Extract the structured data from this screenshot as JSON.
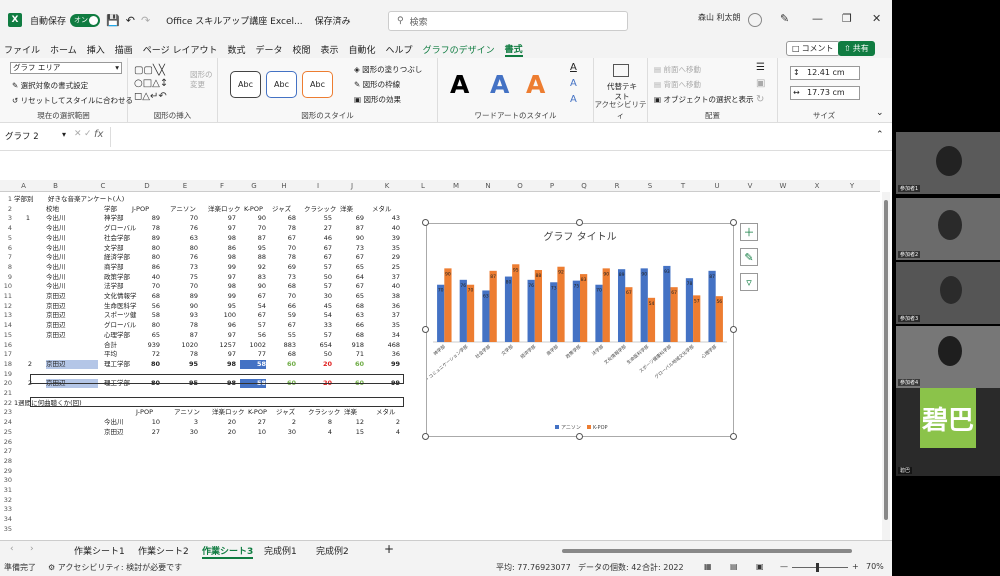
{
  "window": {
    "title": "Office スキルアップ講座 Excel...",
    "saved_label": "保存済み",
    "autosave_label": "自動保存",
    "autosave_state": "オン",
    "search_placeholder": "検索",
    "user_name": "森山 利太朗"
  },
  "menu": {
    "items": [
      "ファイル",
      "ホーム",
      "挿入",
      "描画",
      "ページ レイアウト",
      "数式",
      "データ",
      "校閲",
      "表示",
      "自動化",
      "ヘルプ"
    ],
    "chart_design": "グラフのデザイン",
    "format": "書式",
    "comment": "コメント",
    "share": "共有"
  },
  "ribbon": {
    "chart_area": "グラフ エリア",
    "format_selection": "選択対象の書式設定",
    "reset_style": "リセットしてスタイルに合わせる",
    "group_current": "現在の選択範囲",
    "shape_change": "図形の変更",
    "group_insert": "図形の挿入",
    "abc": "Abc",
    "fill": "図形の塗りつぶし",
    "outline": "図形の枠線",
    "effects": "図形の効果",
    "group_shape_styles": "図形のスタイル",
    "letter_a": "A",
    "group_wordart": "ワードアートのスタイル",
    "alt_text": "代替テキスト",
    "group_access": "アクセシビリティ",
    "bring_forward": "前面へ移動",
    "send_backward": "背面へ移動",
    "selection_pane": "オブジェクトの選択と表示",
    "group_arrange": "配置",
    "height": "12.41 cm",
    "width": "17.73 cm",
    "group_size": "サイズ"
  },
  "formula_bar": {
    "name_box": "グラフ 2",
    "fx": "fx"
  },
  "columns": [
    "A",
    "B",
    "C",
    "D",
    "E",
    "F",
    "G",
    "H",
    "I",
    "J",
    "K",
    "L",
    "M",
    "N",
    "O",
    "P",
    "Q",
    "R",
    "S",
    "T",
    "U",
    "V",
    "W",
    "X",
    "Y"
  ],
  "rows": [
    "1",
    "2",
    "3",
    "4",
    "5",
    "6",
    "7",
    "8",
    "9",
    "10",
    "11",
    "12",
    "13",
    "14",
    "15",
    "16",
    "17",
    "18",
    "19",
    "20",
    "21",
    "22",
    "23",
    "24",
    "25",
    "26",
    "27",
    "28",
    "29",
    "30",
    "31",
    "32",
    "33",
    "34",
    "35"
  ],
  "sheet": {
    "r1a": "学部別",
    "r1b": "好きな音楽アンケート(人)",
    "header": [
      "校地",
      "学部",
      "J-POP",
      "アニソン",
      "洋楽ロック",
      "K-POP",
      "ジャズ",
      "クラシック",
      "洋楽",
      "メタル"
    ],
    "data": [
      [
        "1",
        "今出川",
        "神学部",
        "89",
        "70",
        "97",
        "90",
        "68",
        "55",
        "69",
        "43"
      ],
      [
        "",
        "今出川",
        "グローバル",
        "78",
        "76",
        "97",
        "70",
        "78",
        "27",
        "87",
        "40"
      ],
      [
        "",
        "今出川",
        "社会学部",
        "89",
        "63",
        "98",
        "87",
        "67",
        "46",
        "90",
        "39"
      ],
      [
        "",
        "今出川",
        "文学部",
        "80",
        "80",
        "86",
        "95",
        "70",
        "67",
        "73",
        "35"
      ],
      [
        "",
        "今出川",
        "経済学部",
        "80",
        "76",
        "98",
        "88",
        "78",
        "67",
        "67",
        "29"
      ],
      [
        "",
        "今出川",
        "商学部",
        "86",
        "73",
        "99",
        "92",
        "69",
        "57",
        "65",
        "25"
      ],
      [
        "",
        "今出川",
        "政策学部",
        "40",
        "75",
        "97",
        "83",
        "73",
        "50",
        "64",
        "37"
      ],
      [
        "",
        "今出川",
        "法学部",
        "70",
        "70",
        "98",
        "90",
        "68",
        "57",
        "67",
        "40"
      ],
      [
        "",
        "京田辺",
        "文化情報学",
        "68",
        "89",
        "99",
        "67",
        "70",
        "30",
        "65",
        "38"
      ],
      [
        "",
        "京田辺",
        "生命医科学",
        "56",
        "90",
        "95",
        "54",
        "66",
        "45",
        "68",
        "36"
      ],
      [
        "",
        "京田辺",
        "スポーツ健",
        "58",
        "93",
        "100",
        "67",
        "59",
        "54",
        "63",
        "37"
      ],
      [
        "",
        "京田辺",
        "グローバル",
        "80",
        "78",
        "96",
        "57",
        "67",
        "33",
        "66",
        "35"
      ],
      [
        "",
        "京田辺",
        "心理学部",
        "65",
        "87",
        "97",
        "56",
        "55",
        "57",
        "68",
        "34"
      ]
    ],
    "total_label": "合計",
    "totals": [
      "939",
      "1020",
      "1257",
      "1002",
      "883",
      "654",
      "918",
      "468"
    ],
    "avg_label": "平均",
    "avgs": [
      "72",
      "78",
      "97",
      "77",
      "68",
      "50",
      "71",
      "36"
    ],
    "row18": [
      "2",
      "京田辺",
      "理工学部",
      "80",
      "95",
      "98",
      "58",
      "60",
      "20",
      "60",
      "99"
    ],
    "row20": [
      "2",
      "京田辺",
      "理工学部",
      "80",
      "95",
      "98",
      "58",
      "60",
      "20",
      "60",
      "99"
    ],
    "r22a": "1週間に何曲聴くか(回)",
    "header2": [
      "J-POP",
      "アニソン",
      "洋楽ロック",
      "K-POP",
      "ジャズ",
      "クラシック",
      "洋楽",
      "メタル"
    ],
    "week1": [
      "今出川",
      "10",
      "3",
      "20",
      "27",
      "2",
      "8",
      "12",
      "2"
    ],
    "week2": [
      "京田辺",
      "27",
      "30",
      "20",
      "10",
      "30",
      "4",
      "15",
      "4"
    ]
  },
  "chart_data": {
    "type": "bar",
    "title": "グラフ タイトル",
    "categories": [
      "神学部",
      "グローバル・コミュニケーション学部",
      "社会学部",
      "文学部",
      "経済学部",
      "商学部",
      "政策学部",
      "法学部",
      "文化情報学部",
      "生命医科学部",
      "スポーツ健康科学部",
      "グローバル地域文化学部",
      "心理学部"
    ],
    "series": [
      {
        "name": "アニソン",
        "color": "#4472c4",
        "values": [
          70,
          76,
          63,
          80,
          76,
          73,
          75,
          70,
          89,
          90,
          93,
          78,
          87
        ]
      },
      {
        "name": "K-POP",
        "color": "#ed7d31",
        "values": [
          90,
          70,
          87,
          95,
          88,
          92,
          83,
          90,
          67,
          54,
          67,
          57,
          56
        ]
      }
    ],
    "ylim": [
      0,
      110
    ],
    "legend": "bottom"
  },
  "tabs": [
    "作業シート1",
    "作業シート2",
    "作業シート3",
    "完成例1",
    "完成例2"
  ],
  "active_tab": 2,
  "status": {
    "ready": "準備完了",
    "accessibility": "アクセシビリティ: 検討が必要です",
    "average": "平均: 77.76923077",
    "count": "データの個数: 42",
    "sum": "合計: 2022",
    "zoom": "70%"
  },
  "participants": [
    {
      "name": "参加者1"
    },
    {
      "name": "参加者2"
    },
    {
      "name": "参加者3"
    },
    {
      "name": "参加者4"
    },
    {
      "name": "碧巴",
      "avatar": "碧巴"
    }
  ]
}
